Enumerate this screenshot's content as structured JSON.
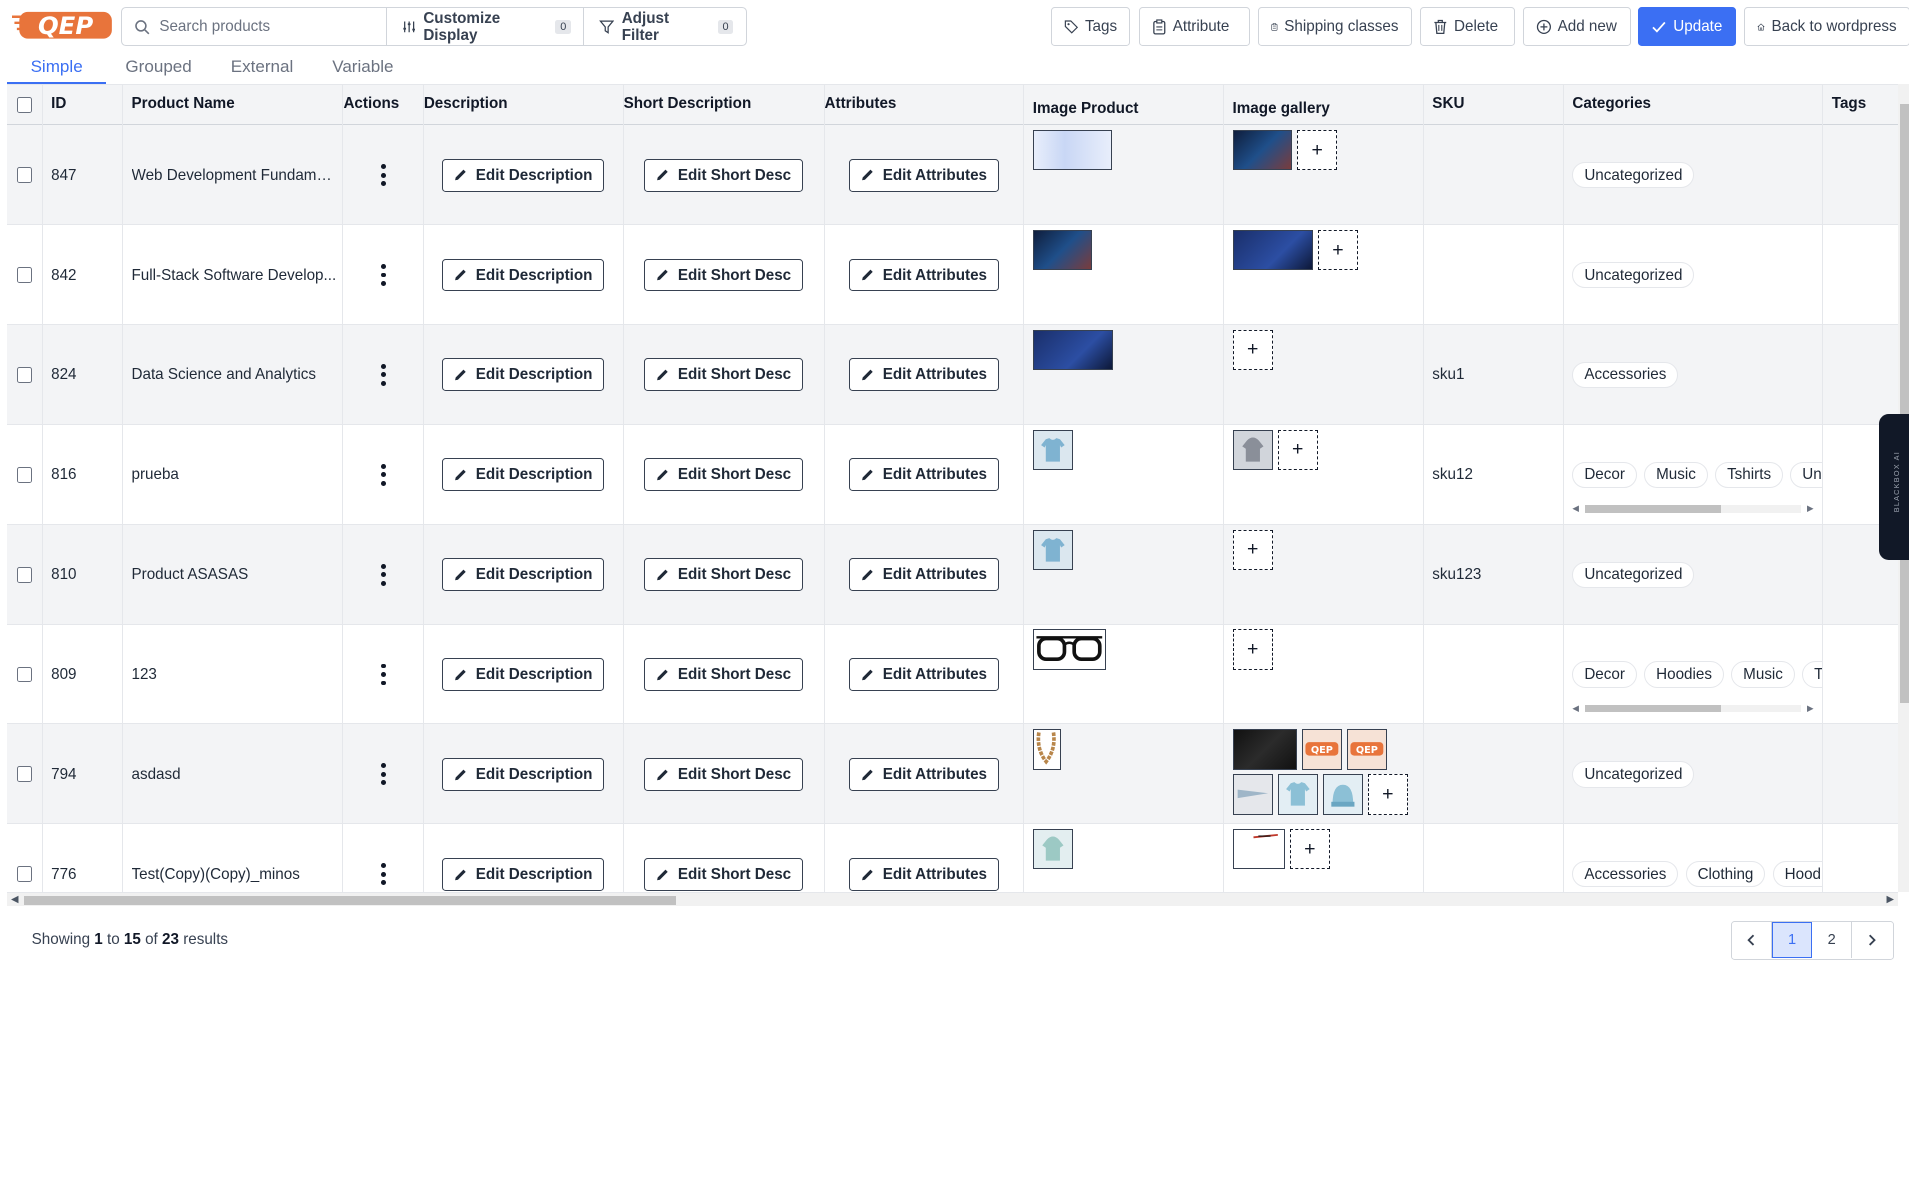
{
  "brand": {
    "logo_text": "QEP",
    "accent": "#3b6ff3",
    "logo_color": "#e8743b"
  },
  "toolbar": {
    "search_placeholder": "Search products",
    "customize_label": "Customize Display",
    "customize_count": "0",
    "filter_label": "Adjust Filter",
    "filter_count": "0",
    "tags_label": "Tags",
    "attribute_label": "Attribute",
    "shipping_label": "Shipping classes",
    "delete_label": "Delete",
    "add_new_label": "Add new",
    "update_label": "Update",
    "back_label": "Back to wordpress"
  },
  "tabs": [
    "Simple",
    "Grouped",
    "External",
    "Variable"
  ],
  "columns": [
    "ID",
    "Product Name",
    "Actions",
    "Description",
    "Short Description",
    "Attributes",
    "Image Product",
    "Image gallery",
    "SKU",
    "Categories",
    "Tags"
  ],
  "row_actions": {
    "edit_description": "Edit Description",
    "edit_short": "Edit Short Desc",
    "edit_attributes": "Edit Attributes",
    "add_symbol": "+"
  },
  "rows": [
    {
      "id": "847",
      "name": "Web Development Fundamen...",
      "sku": "",
      "categories": [
        "Uncategorized"
      ]
    },
    {
      "id": "842",
      "name": "Full-Stack Software Develop...",
      "sku": "",
      "categories": [
        "Uncategorized"
      ]
    },
    {
      "id": "824",
      "name": "Data Science and Analytics",
      "sku": "sku1",
      "categories": [
        "Accessories"
      ]
    },
    {
      "id": "816",
      "name": "prueba",
      "sku": "sku12",
      "categories": [
        "Decor",
        "Music",
        "Tshirts",
        "Uncate"
      ]
    },
    {
      "id": "810",
      "name": "Product ASASAS",
      "sku": "sku123",
      "categories": [
        "Uncategorized"
      ]
    },
    {
      "id": "809",
      "name": "123",
      "sku": "",
      "categories": [
        "Decor",
        "Hoodies",
        "Music",
        "Tshirt"
      ]
    },
    {
      "id": "794",
      "name": "asdasd",
      "sku": "",
      "categories": [
        "Uncategorized"
      ]
    },
    {
      "id": "776",
      "name": "Test(Copy)(Copy)_minos",
      "sku": "",
      "categories": [
        "Accessories",
        "Clothing",
        "Hoodies"
      ]
    }
  ],
  "footer": {
    "showing_prefix": "Showing",
    "from": "1",
    "to_word": "to",
    "to": "15",
    "of_word": "of",
    "total": "23",
    "results_word": "results"
  },
  "pagination": {
    "pages": [
      "1",
      "2"
    ],
    "current": "1"
  },
  "side_widget": {
    "text": "BLACKBOX AI"
  }
}
